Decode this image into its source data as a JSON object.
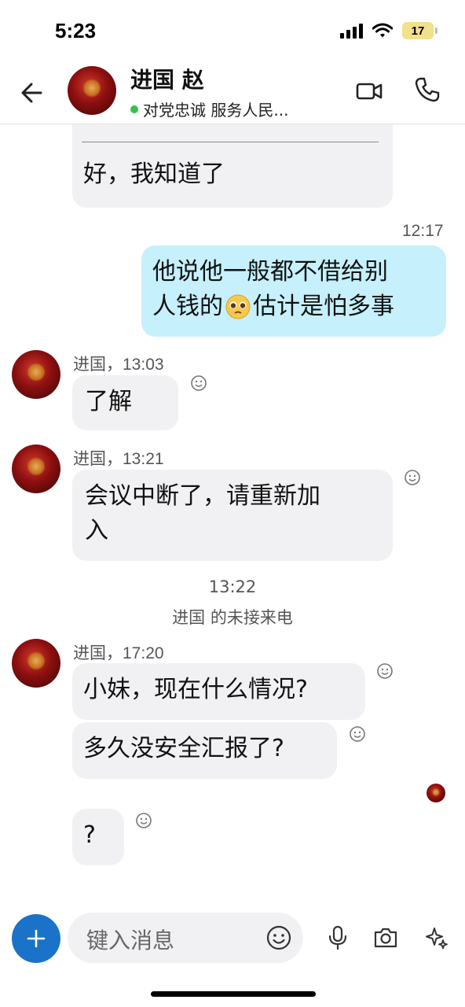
{
  "status_bar": {
    "time": "5:23",
    "battery": "17"
  },
  "header": {
    "name": "进国 赵",
    "status": "对党忠诚 服务人民..."
  },
  "messages": {
    "quoted_reply": "好，我知道了",
    "outgoing": {
      "time": "12:17",
      "text_line1": "他说他一般都不借给别",
      "text_line2_a": "人钱的",
      "text_line2_b": "估计是怕多事"
    },
    "msg1": {
      "meta": "进国，13:03",
      "text": "了解"
    },
    "msg2": {
      "meta": "进国，13:21",
      "text_line1": "会议中断了，请重新加",
      "text_line2": "入"
    },
    "missed_call": {
      "time": "13:22",
      "text": "进国 的未接来电"
    },
    "msg3": {
      "meta": "进国，17:20",
      "text": "小妹，现在什么情况?"
    },
    "msg4": {
      "text": "多久没安全汇报了?"
    },
    "msg5": {
      "text": "?"
    }
  },
  "composer": {
    "placeholder": "键入消息"
  },
  "colors": {
    "accent": "#1a73c8",
    "outgoing_bubble": "#c6f0fb",
    "incoming_bubble": "#f1f1f3",
    "online": "#35c14d"
  },
  "icons": [
    "back-arrow-icon",
    "video-camera-icon",
    "phone-icon",
    "smiley-react-icon",
    "plus-icon",
    "emoji-icon",
    "microphone-icon",
    "camera-icon",
    "sparkle-icon",
    "pleading-face-emoji"
  ]
}
